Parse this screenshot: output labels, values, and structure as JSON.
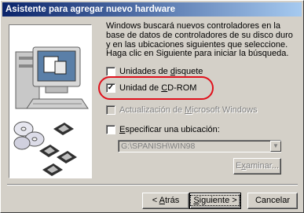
{
  "window": {
    "title": "Asistente para agregar nuevo hardware"
  },
  "description": "Windows buscará nuevos controladores en la base de datos de controladores de su disco duro y en las ubicaciones siguientes que seleccione. Haga clic en Siguiente para iniciar la búsqueda.",
  "options": [
    {
      "label_pre": "Unidades de ",
      "label_key": "d",
      "label_post": "isquete",
      "checked": false,
      "enabled": true
    },
    {
      "label_pre": "Unidad de ",
      "label_key": "C",
      "label_post": "D-ROM",
      "checked": true,
      "enabled": true
    },
    {
      "label_pre": "Actualización de ",
      "label_key": "M",
      "label_post": "icrosoft Windows",
      "checked": false,
      "enabled": false
    },
    {
      "label_pre": "",
      "label_key": "E",
      "label_post": "specificar una ubicación:",
      "checked": false,
      "enabled": true
    }
  ],
  "location": {
    "value": "G:\\SPANISH\\WIN98"
  },
  "buttons": {
    "browse": {
      "pre": "E",
      "key": "x",
      "post": "aminar..."
    },
    "back": {
      "pre": "< ",
      "key": "A",
      "post": "trás"
    },
    "next": {
      "pre": "",
      "key": "S",
      "post": "iguiente >"
    },
    "cancel": "Cancelar"
  },
  "colors": {
    "highlight_ring": "#e0101b",
    "title_start": "#0a246a"
  },
  "icons": [
    "computer-icon",
    "cd-disc-icon",
    "floppy-disk-icon"
  ]
}
